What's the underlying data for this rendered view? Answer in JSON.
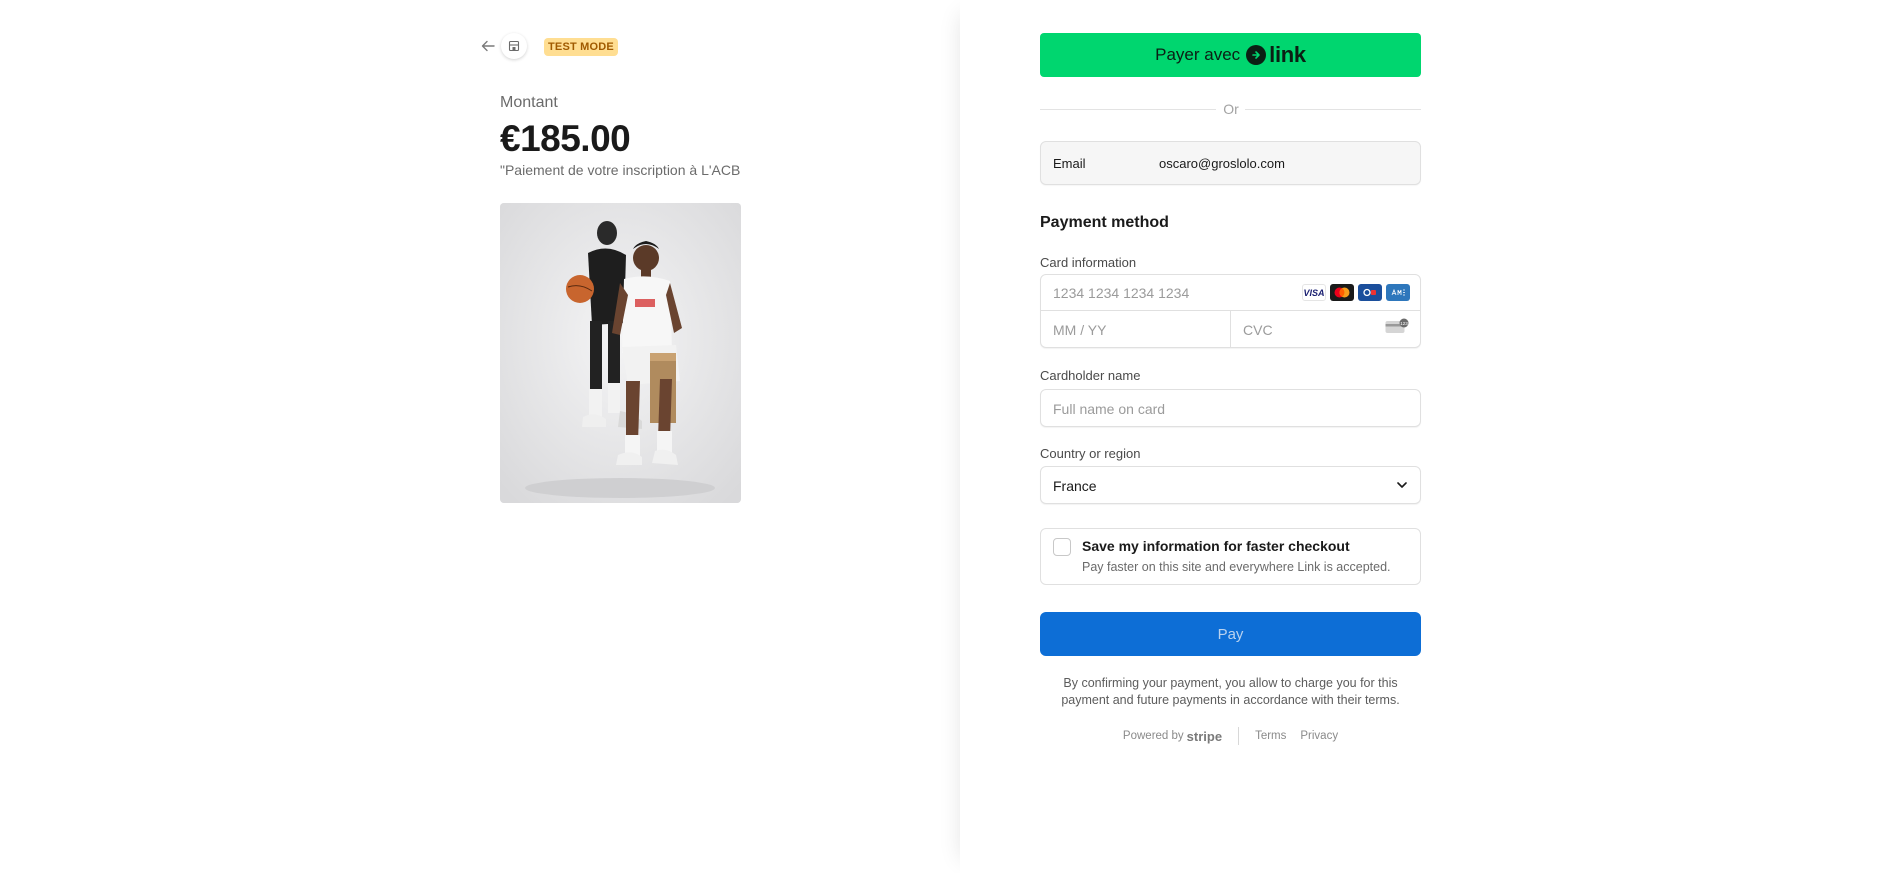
{
  "header": {
    "back_icon": "arrow-left-icon",
    "store_icon": "store-icon",
    "test_mode_label": "TEST MODE"
  },
  "summary": {
    "amount_label": "Montant",
    "amount_value": "€185.00",
    "description": "\"Paiement de votre inscription à L'ACB",
    "product_image": "photo of two basketball players in white studio"
  },
  "checkout": {
    "link_button": {
      "prefix": "Payer avec",
      "logo_word": "link",
      "color": "#00d66f"
    },
    "divider_label": "Or",
    "email": {
      "label": "Email",
      "value": "oscaro@groslolo.com"
    },
    "payment_method_title": "Payment method",
    "card_information_label": "Card information",
    "card_number_placeholder": "1234 1234 1234 1234",
    "card_brands": [
      "VISA",
      "Mastercard",
      "CB",
      "American Express"
    ],
    "expiry_placeholder": "MM / YY",
    "cvc_placeholder": "CVC",
    "cardholder_label": "Cardholder name",
    "cardholder_placeholder": "Full name on card",
    "country_label": "Country or region",
    "country_value": "France",
    "save_info_title": "Save my information for faster checkout",
    "save_info_subtitle": "Pay faster on this site and everywhere Link is accepted.",
    "pay_button": "Pay",
    "pay_button_color": "#0d6ed6",
    "legal_text": "By confirming your payment, you allow to charge you for this payment and future payments in accordance with their terms."
  },
  "footer": {
    "powered_by": "Powered by",
    "brand": "stripe",
    "terms": "Terms",
    "privacy": "Privacy"
  }
}
